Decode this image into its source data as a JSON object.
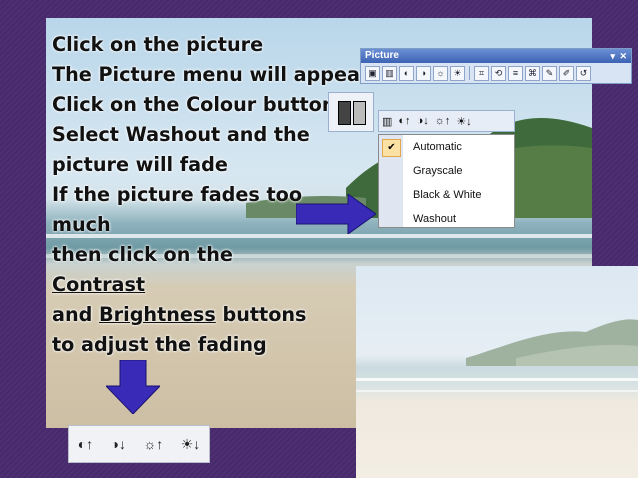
{
  "slide": {
    "lines": [
      {
        "text": "Click on the picture"
      },
      {
        "text": "The Picture menu will appear"
      },
      {
        "text": "Click on the Colour button"
      },
      {
        "text": "Select Washout and the"
      },
      {
        "text": "picture will fade"
      },
      {
        "text": "If the picture fades too"
      },
      {
        "text": "much"
      },
      {
        "text": "then click on the"
      },
      {
        "text": "Contrast",
        "underline": true
      },
      {
        "text": "and ",
        "underlined_word": "Brightness",
        "rest": " buttons"
      },
      {
        "text": "to adjust the fading"
      }
    ]
  },
  "picture_toolbar": {
    "title": "Picture",
    "buttons": [
      "insert-picture-icon",
      "color-icon",
      "more-contrast-icon",
      "less-contrast-icon",
      "more-brightness-icon",
      "less-brightness-icon",
      "crop-icon",
      "rotate-icon",
      "line-style-icon",
      "compress-icon",
      "format-icon",
      "transparent-color-icon",
      "reset-icon"
    ]
  },
  "color_menu": {
    "items": [
      "Automatic",
      "Grayscale",
      "Black & White",
      "Washout"
    ],
    "checked": "Automatic"
  },
  "colors": {
    "background": "#4b2c6e",
    "arrow": "#3a2ab8",
    "menu_gutter": "#dfe6f1"
  }
}
